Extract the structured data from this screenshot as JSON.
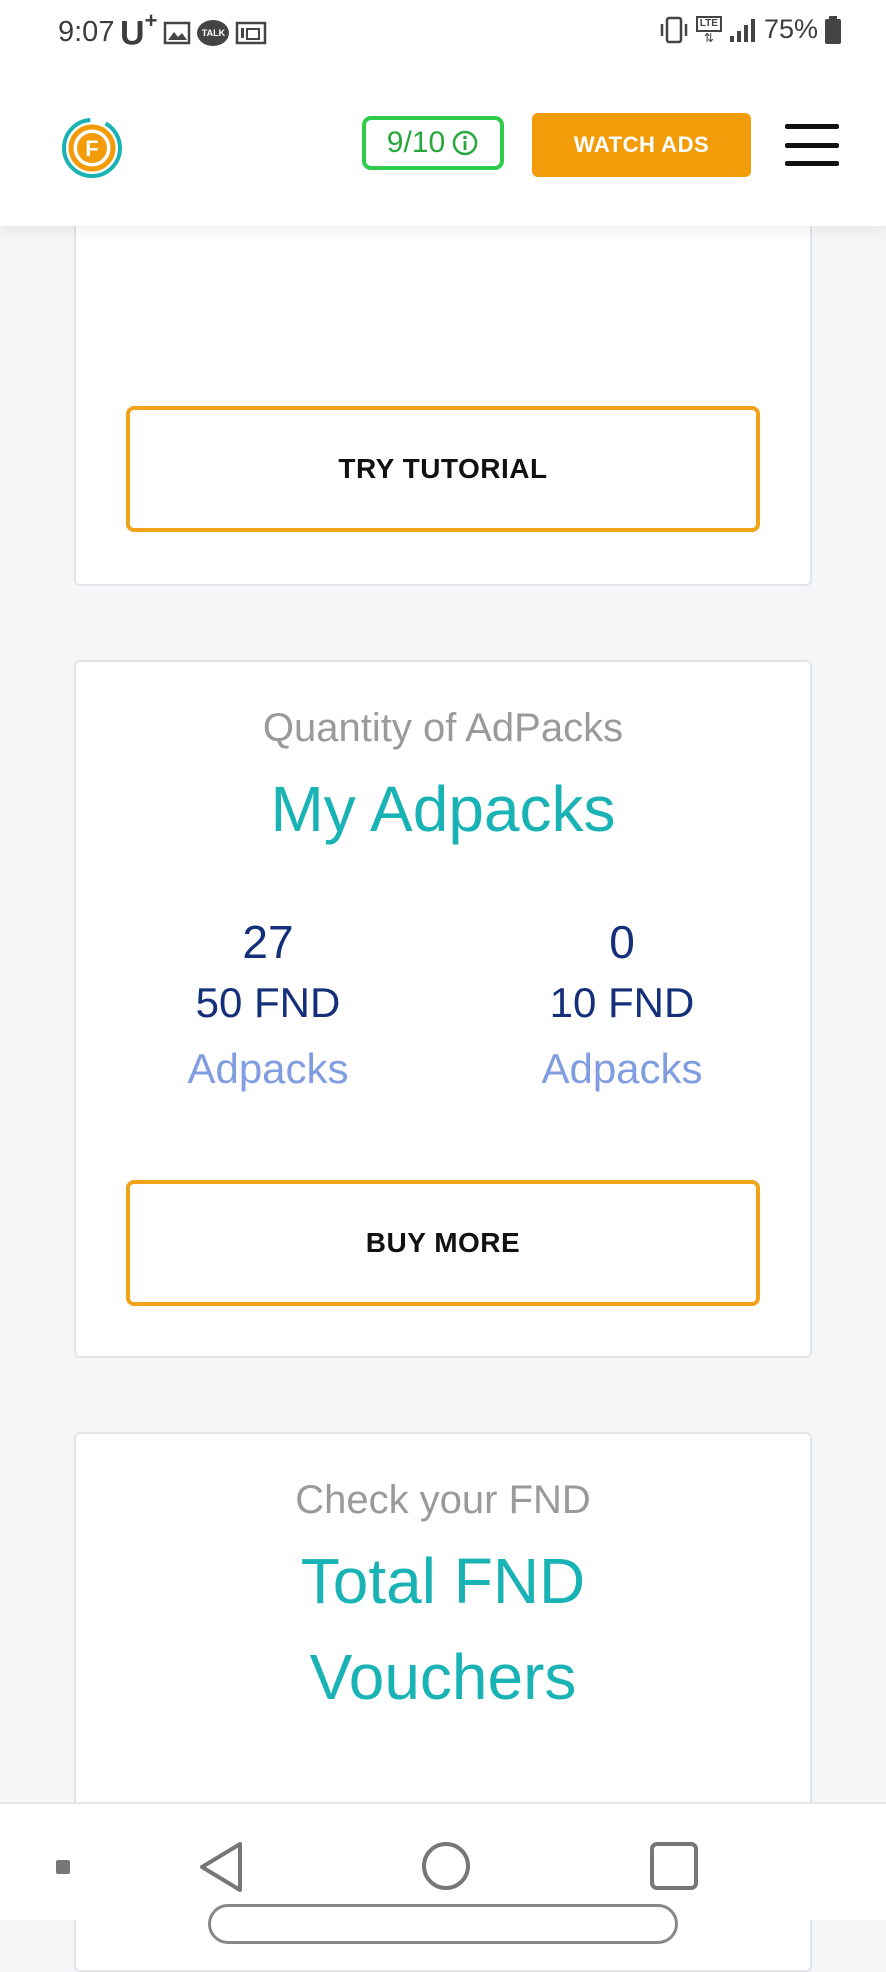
{
  "status_bar": {
    "time": "9:07",
    "carrier": "U",
    "carrier_plus": "+",
    "talk_badge": "TALK",
    "network": "LTE",
    "battery": "75%",
    "icons": [
      "gallery-icon",
      "kakaotalk-icon",
      "screenshot-icon",
      "vibrate-icon",
      "lte-icon",
      "signal-icon",
      "battery-icon"
    ]
  },
  "header": {
    "logo_letter": "F",
    "ad_counter": "9/10",
    "watch_ads_label": "WATCH ADS",
    "colors": {
      "accent": "#f39c0a",
      "counter_green": "#2ecc4a",
      "teal": "#1ab3b5",
      "navy": "#15307a",
      "link_blue": "#7f9de0"
    }
  },
  "tutorial_card": {
    "button_label": "TRY TUTORIAL"
  },
  "adpacks_card": {
    "subtitle": "Quantity of AdPacks",
    "title": "My Adpacks",
    "stats": [
      {
        "count": "27",
        "unit": "50 FND",
        "label": "Adpacks"
      },
      {
        "count": "0",
        "unit": "10 FND",
        "label": "Adpacks"
      }
    ],
    "button_label": "BUY MORE"
  },
  "vouchers_card": {
    "subtitle": "Check your FND",
    "title_line1": "Total FND",
    "title_line2": "Vouchers"
  },
  "nav_bar": {
    "icons": [
      "recent-dot-icon",
      "back-icon",
      "home-icon",
      "overview-icon"
    ]
  }
}
